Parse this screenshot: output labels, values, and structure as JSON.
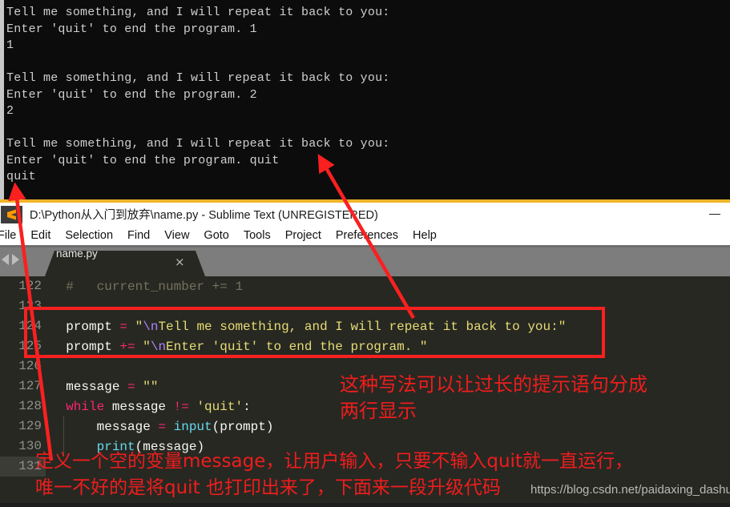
{
  "terminal": {
    "name": "console-output",
    "lines": [
      "Tell me something, and I will repeat it back to you:",
      "Enter 'quit' to end the program. 1",
      "1",
      "",
      "Tell me something, and I will repeat it back to you:",
      "Enter 'quit' to end the program. 2",
      "2",
      "",
      "Tell me something, and I will repeat it back to you:",
      "Enter 'quit' to end the program. quit",
      "quit"
    ]
  },
  "window": {
    "title": "D:\\Python从入门到放弃\\name.py - Sublime Text (UNREGISTERED)",
    "app_icon": "sublime-text-logo",
    "minimize_label": "—"
  },
  "menubar": {
    "items": [
      {
        "label": "File"
      },
      {
        "label": "Edit"
      },
      {
        "label": "Selection"
      },
      {
        "label": "Find"
      },
      {
        "label": "View"
      },
      {
        "label": "Goto"
      },
      {
        "label": "Tools"
      },
      {
        "label": "Project"
      },
      {
        "label": "Preferences"
      },
      {
        "label": "Help"
      }
    ]
  },
  "tabbar": {
    "prev_icon": "chevron-left-icon",
    "next_icon": "chevron-right-icon",
    "tab_label": "name.py",
    "close_icon": "×"
  },
  "editor": {
    "rows": [
      {
        "num": "122",
        "segments": [
          {
            "cls": "tok-comment",
            "t": "  #   current_number += 1"
          }
        ]
      },
      {
        "num": "123",
        "segments": [
          {
            "cls": "tok-plain",
            "t": ""
          }
        ]
      },
      {
        "num": "124",
        "segments": [
          {
            "cls": "tok-plain",
            "t": "  prompt "
          },
          {
            "cls": "tok-op",
            "t": "= "
          },
          {
            "cls": "tok-str",
            "t": "\""
          },
          {
            "cls": "tok-esc",
            "t": "\\n"
          },
          {
            "cls": "tok-str",
            "t": "Tell me something, and I will repeat it back to you:\""
          }
        ]
      },
      {
        "num": "125",
        "segments": [
          {
            "cls": "tok-plain",
            "t": "  prompt "
          },
          {
            "cls": "tok-op",
            "t": "+= "
          },
          {
            "cls": "tok-str",
            "t": "\""
          },
          {
            "cls": "tok-esc",
            "t": "\\n"
          },
          {
            "cls": "tok-str",
            "t": "Enter 'quit' to end the program. \""
          }
        ]
      },
      {
        "num": "126",
        "segments": [
          {
            "cls": "tok-plain",
            "t": ""
          }
        ]
      },
      {
        "num": "127",
        "segments": [
          {
            "cls": "tok-plain",
            "t": "  message "
          },
          {
            "cls": "tok-op",
            "t": "= "
          },
          {
            "cls": "tok-str",
            "t": "\"\""
          }
        ]
      },
      {
        "num": "128",
        "segments": [
          {
            "cls": "tok-plain",
            "t": "  "
          },
          {
            "cls": "tok-kw",
            "t": "while"
          },
          {
            "cls": "tok-plain",
            "t": " message "
          },
          {
            "cls": "tok-op",
            "t": "!= "
          },
          {
            "cls": "tok-str",
            "t": "'quit'"
          },
          {
            "cls": "tok-plain",
            "t": ":"
          }
        ]
      },
      {
        "num": "129",
        "segments": [
          {
            "cls": "tok-plain",
            "t": "      message "
          },
          {
            "cls": "tok-op",
            "t": "= "
          },
          {
            "cls": "tok-fn",
            "t": "input"
          },
          {
            "cls": "tok-plain",
            "t": "(prompt)"
          }
        ],
        "guide": true
      },
      {
        "num": "130",
        "segments": [
          {
            "cls": "tok-plain",
            "t": "      "
          },
          {
            "cls": "tok-fn",
            "t": "print"
          },
          {
            "cls": "tok-plain",
            "t": "(message)"
          }
        ],
        "guide": true
      },
      {
        "num": "131",
        "segments": [
          {
            "cls": "tok-plain",
            "t": ""
          }
        ],
        "current": true
      }
    ]
  },
  "annotations": {
    "accent_red": "#ee1d1d",
    "right_note_line1": "这种写法可以让过长的提示语句分成",
    "right_note_line2": "两行显示",
    "bottom_note_line1": "定义一个空的变量message，让用户输入，只要不输入quit就一直运行，",
    "bottom_note_line2": "唯一不好的是将quit 也打印出来了，下面来一段升级代码",
    "watermark": "https://blog.csdn.net/paidaxing_dashu"
  }
}
